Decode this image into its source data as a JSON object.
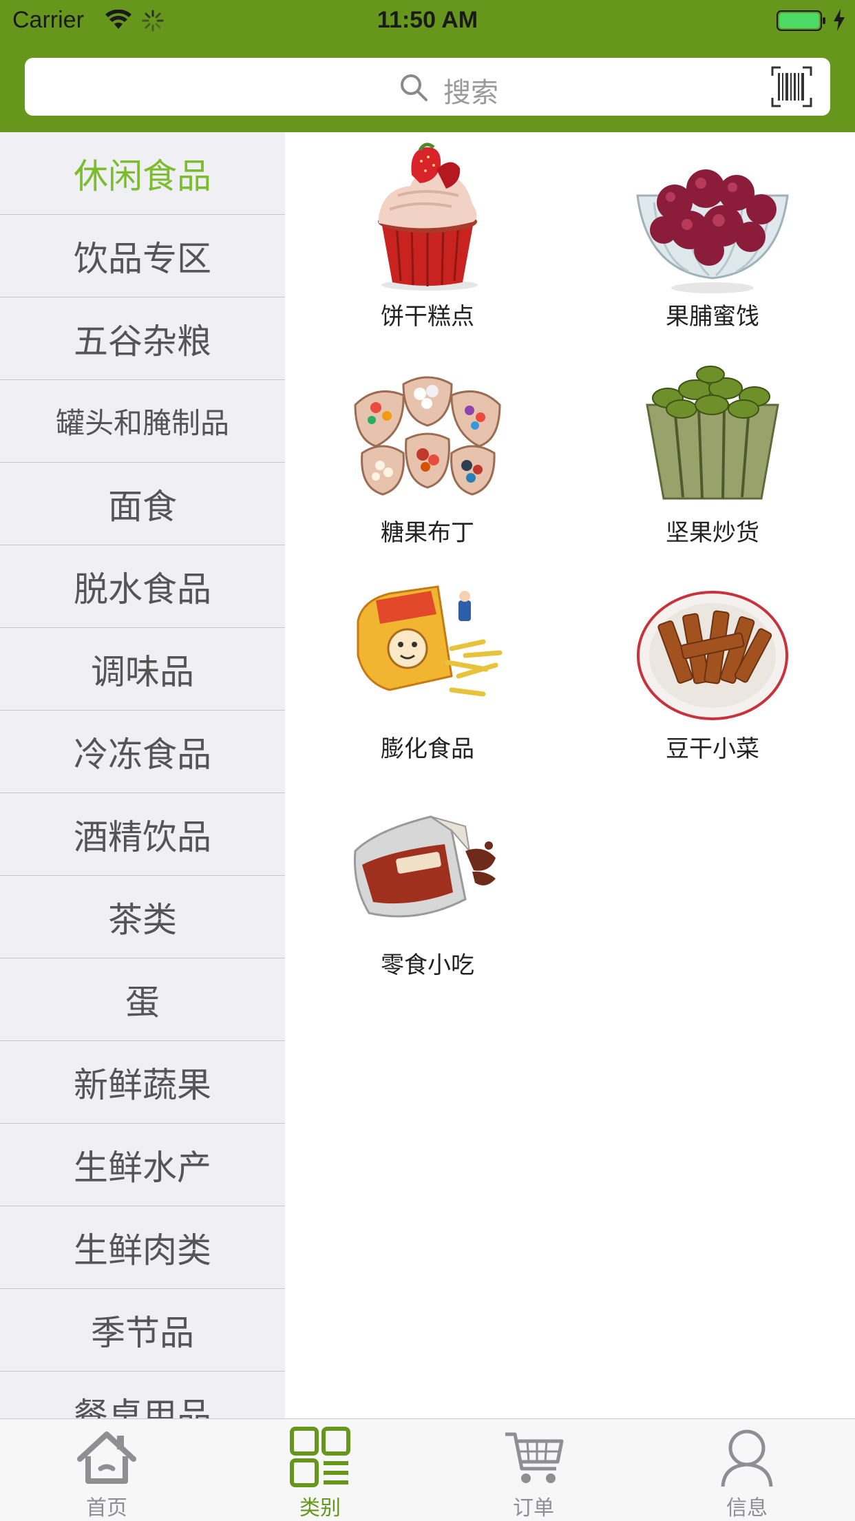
{
  "status_bar": {
    "carrier": "Carrier",
    "time": "11:50 AM"
  },
  "search": {
    "placeholder": "搜索"
  },
  "colors": {
    "brand_green": "#66961c",
    "active_category": "#7cbd2e",
    "sidebar_bg": "#efeff4"
  },
  "sidebar": {
    "active_index": 0,
    "items": [
      "休闲食品",
      "饮品专区",
      "五谷杂粮",
      "罐头和腌制品",
      "面食",
      "脱水食品",
      "调味品",
      "冷冻食品",
      "酒精饮品",
      "茶类",
      "蛋",
      "新鲜蔬果",
      "生鲜水产",
      "生鲜肉类",
      "季节品",
      "餐桌用品"
    ]
  },
  "subcategories": [
    {
      "label": "饼干糕点",
      "icon": "cupcake"
    },
    {
      "label": "果脯蜜饯",
      "icon": "dried-fruit-bowl"
    },
    {
      "label": "糖果布丁",
      "icon": "candy-bags"
    },
    {
      "label": "坚果炒货",
      "icon": "nut-basket"
    },
    {
      "label": "膨化食品",
      "icon": "puffed-snack-bag"
    },
    {
      "label": "豆干小菜",
      "icon": "tofu-plate"
    },
    {
      "label": "零食小吃",
      "icon": "jerky-bag"
    }
  ],
  "tabbar": {
    "active_index": 1,
    "tabs": [
      {
        "label": "首页",
        "icon": "home-icon"
      },
      {
        "label": "类别",
        "icon": "category-grid-icon"
      },
      {
        "label": "订单",
        "icon": "cart-icon"
      },
      {
        "label": "信息",
        "icon": "person-icon"
      }
    ]
  }
}
